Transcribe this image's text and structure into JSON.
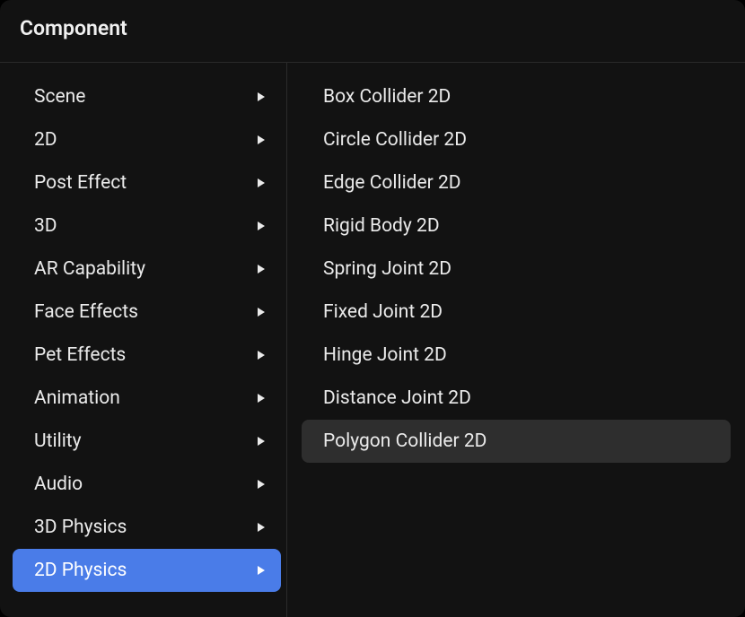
{
  "header": {
    "title": "Component"
  },
  "categories": [
    {
      "id": "scene",
      "label": "Scene",
      "selected": false
    },
    {
      "id": "2d",
      "label": "2D",
      "selected": false
    },
    {
      "id": "post-effect",
      "label": "Post Effect",
      "selected": false
    },
    {
      "id": "3d",
      "label": "3D",
      "selected": false
    },
    {
      "id": "ar-capability",
      "label": "AR Capability",
      "selected": false
    },
    {
      "id": "face-effects",
      "label": "Face Effects",
      "selected": false
    },
    {
      "id": "pet-effects",
      "label": "Pet Effects",
      "selected": false
    },
    {
      "id": "animation",
      "label": "Animation",
      "selected": false
    },
    {
      "id": "utility",
      "label": "Utility",
      "selected": false
    },
    {
      "id": "audio",
      "label": "Audio",
      "selected": false
    },
    {
      "id": "3d-physics",
      "label": "3D Physics",
      "selected": false
    },
    {
      "id": "2d-physics",
      "label": "2D Physics",
      "selected": true
    }
  ],
  "subitems": [
    {
      "id": "box-collider-2d",
      "label": "Box Collider 2D",
      "highlight": false
    },
    {
      "id": "circle-collider-2d",
      "label": "Circle Collider 2D",
      "highlight": false
    },
    {
      "id": "edge-collider-2d",
      "label": "Edge Collider 2D",
      "highlight": false
    },
    {
      "id": "rigid-body-2d",
      "label": "Rigid Body 2D",
      "highlight": false
    },
    {
      "id": "spring-joint-2d",
      "label": "Spring Joint 2D",
      "highlight": false
    },
    {
      "id": "fixed-joint-2d",
      "label": "Fixed Joint 2D",
      "highlight": false
    },
    {
      "id": "hinge-joint-2d",
      "label": "Hinge Joint 2D",
      "highlight": false
    },
    {
      "id": "distance-joint-2d",
      "label": "Distance Joint 2D",
      "highlight": false
    },
    {
      "id": "polygon-collider-2d",
      "label": "Polygon Collider 2D",
      "highlight": true
    }
  ]
}
